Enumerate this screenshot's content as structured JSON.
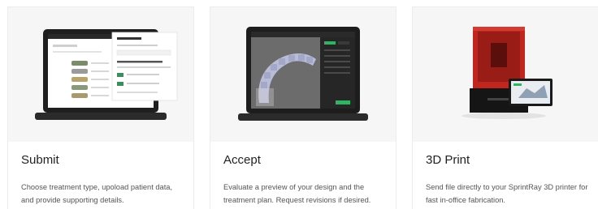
{
  "cards": [
    {
      "title": "Submit",
      "description": "Choose treatment type, upoload patient data, and provide supporting details.",
      "image": "tablet-app-patient-files"
    },
    {
      "title": "Accept",
      "description": "Evaluate a preview of your design and the treatment plan. Request revisions if desired.",
      "image": "tablet-3d-dental-preview"
    },
    {
      "title": "3D Print",
      "description": "Send file directly to your SprintRay 3D printer for fast in-office fabrication.",
      "image": "sprintray-3d-printer"
    }
  ],
  "colors": {
    "card_media_bg": "#f6f6f6",
    "printer_red": "#c0261e",
    "accent_green": "#2fb463"
  }
}
